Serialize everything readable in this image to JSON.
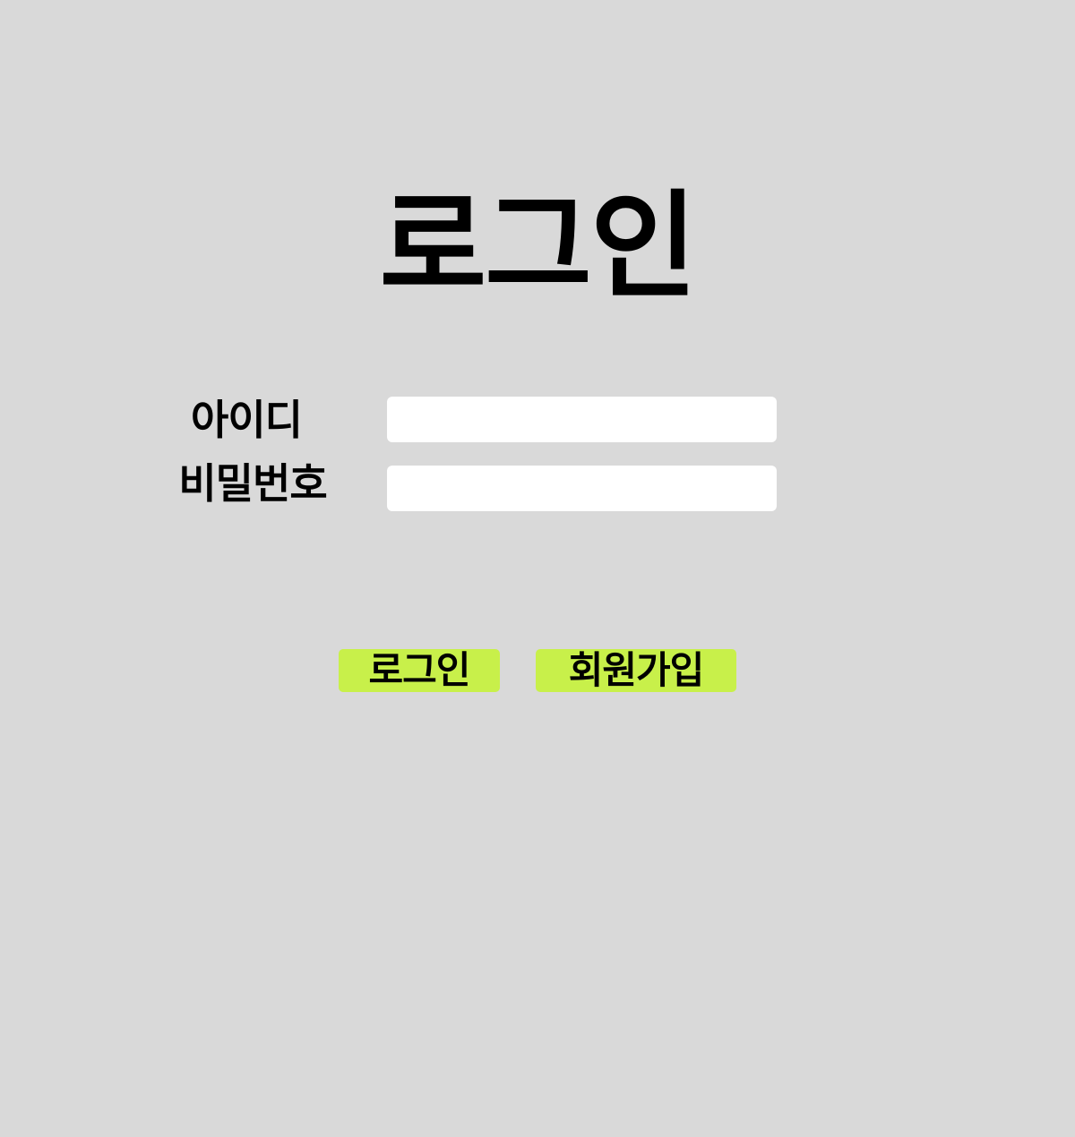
{
  "page": {
    "title": "로그인",
    "background_color": "#d9d9d9"
  },
  "form": {
    "id_label": "아이디",
    "id_value": "",
    "password_label": "비밀번호",
    "password_value": ""
  },
  "buttons": {
    "login_label": "로그인",
    "signup_label": "회원가입",
    "accent_color": "#c8f04a"
  }
}
